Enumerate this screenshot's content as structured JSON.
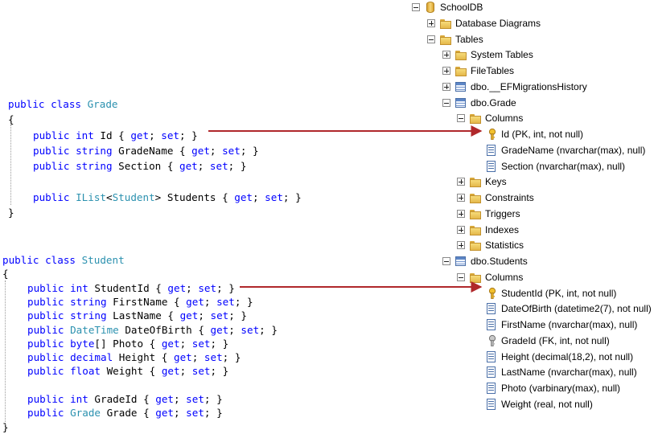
{
  "code": {
    "grade_class": [
      [
        [
          "kw",
          "public class "
        ],
        [
          "ty",
          "Grade"
        ]
      ],
      [
        [
          "",
          "{"
        ]
      ],
      [
        [
          "kw",
          "public int "
        ],
        [
          "",
          "Id { "
        ],
        [
          "kw",
          "get"
        ],
        [
          "",
          "; "
        ],
        [
          "kw",
          "set"
        ],
        [
          "",
          "; }"
        ]
      ],
      [
        [
          "kw",
          "public string "
        ],
        [
          "",
          "GradeName { "
        ],
        [
          "kw",
          "get"
        ],
        [
          "",
          "; "
        ],
        [
          "kw",
          "set"
        ],
        [
          "",
          "; }"
        ]
      ],
      [
        [
          "kw",
          "public string "
        ],
        [
          "",
          "Section { "
        ],
        [
          "kw",
          "get"
        ],
        [
          "",
          "; "
        ],
        [
          "kw",
          "set"
        ],
        [
          "",
          "; }"
        ]
      ],
      [],
      [
        [
          "kw",
          "public "
        ],
        [
          "ty",
          "IList"
        ],
        [
          "",
          "<"
        ],
        [
          "ty",
          "Student"
        ],
        [
          "",
          "> Students { "
        ],
        [
          "kw",
          "get"
        ],
        [
          "",
          "; "
        ],
        [
          "kw",
          "set"
        ],
        [
          "",
          "; }"
        ]
      ],
      [
        [
          "",
          "}"
        ]
      ]
    ],
    "student_class": [
      [
        [
          "kw",
          "public class "
        ],
        [
          "ty",
          "Student"
        ]
      ],
      [
        [
          "",
          "{"
        ]
      ],
      [
        [
          "kw",
          "public int "
        ],
        [
          "",
          "StudentId { "
        ],
        [
          "kw",
          "get"
        ],
        [
          "",
          "; "
        ],
        [
          "kw",
          "set"
        ],
        [
          "",
          "; }"
        ]
      ],
      [
        [
          "kw",
          "public string "
        ],
        [
          "",
          "FirstName { "
        ],
        [
          "kw",
          "get"
        ],
        [
          "",
          "; "
        ],
        [
          "kw",
          "set"
        ],
        [
          "",
          "; }"
        ]
      ],
      [
        [
          "kw",
          "public string "
        ],
        [
          "",
          "LastName { "
        ],
        [
          "kw",
          "get"
        ],
        [
          "",
          "; "
        ],
        [
          "kw",
          "set"
        ],
        [
          "",
          "; }"
        ]
      ],
      [
        [
          "kw",
          "public "
        ],
        [
          "ty",
          "DateTime"
        ],
        [
          "",
          " DateOfBirth { "
        ],
        [
          "kw",
          "get"
        ],
        [
          "",
          "; "
        ],
        [
          "kw",
          "set"
        ],
        [
          "",
          "; }"
        ]
      ],
      [
        [
          "kw",
          "public byte"
        ],
        [
          "",
          "[] Photo { "
        ],
        [
          "kw",
          "get"
        ],
        [
          "",
          "; "
        ],
        [
          "kw",
          "set"
        ],
        [
          "",
          "; }"
        ]
      ],
      [
        [
          "kw",
          "public decimal "
        ],
        [
          "",
          "Height { "
        ],
        [
          "kw",
          "get"
        ],
        [
          "",
          "; "
        ],
        [
          "kw",
          "set"
        ],
        [
          "",
          "; }"
        ]
      ],
      [
        [
          "kw",
          "public float "
        ],
        [
          "",
          "Weight { "
        ],
        [
          "kw",
          "get"
        ],
        [
          "",
          "; "
        ],
        [
          "kw",
          "set"
        ],
        [
          "",
          "; }"
        ]
      ],
      [],
      [
        [
          "kw",
          "public int "
        ],
        [
          "",
          "GradeId { "
        ],
        [
          "kw",
          "get"
        ],
        [
          "",
          "; "
        ],
        [
          "kw",
          "set"
        ],
        [
          "",
          "; }"
        ]
      ],
      [
        [
          "kw",
          "public "
        ],
        [
          "ty",
          "Grade"
        ],
        [
          "",
          " Grade { "
        ],
        [
          "kw",
          "get"
        ],
        [
          "",
          "; "
        ],
        [
          "kw",
          "set"
        ],
        [
          "",
          "; }"
        ]
      ],
      [
        [
          "",
          "}"
        ]
      ]
    ]
  },
  "tree": [
    {
      "label": "SchoolDB",
      "icon": "database-icon",
      "expander": "minus",
      "level": 0
    },
    {
      "label": "Database Diagrams",
      "icon": "folder-icon",
      "expander": "plus",
      "level": 1
    },
    {
      "label": "Tables",
      "icon": "folder-icon",
      "expander": "minus",
      "level": 1
    },
    {
      "label": "System Tables",
      "icon": "folder-icon",
      "expander": "plus",
      "level": 2
    },
    {
      "label": "FileTables",
      "icon": "folder-icon",
      "expander": "plus",
      "level": 2
    },
    {
      "label": "dbo.__EFMigrationsHistory",
      "icon": "table-icon",
      "expander": "plus",
      "level": 2
    },
    {
      "label": "dbo.Grade",
      "icon": "table-icon",
      "expander": "minus",
      "level": 2
    },
    {
      "label": "Columns",
      "icon": "folder-icon",
      "expander": "minus",
      "level": 3
    },
    {
      "label": "Id (PK, int, not null)",
      "icon": "primary-key-icon",
      "expander": "none",
      "level": 4
    },
    {
      "label": "GradeName (nvarchar(max), null)",
      "icon": "column-icon",
      "expander": "none",
      "level": 4
    },
    {
      "label": "Section (nvarchar(max), null)",
      "icon": "column-icon",
      "expander": "none",
      "level": 4
    },
    {
      "label": "Keys",
      "icon": "folder-icon",
      "expander": "plus",
      "level": 3
    },
    {
      "label": "Constraints",
      "icon": "folder-icon",
      "expander": "plus",
      "level": 3
    },
    {
      "label": "Triggers",
      "icon": "folder-icon",
      "expander": "plus",
      "level": 3
    },
    {
      "label": "Indexes",
      "icon": "folder-icon",
      "expander": "plus",
      "level": 3
    },
    {
      "label": "Statistics",
      "icon": "folder-icon",
      "expander": "plus",
      "level": 3
    },
    {
      "label": "dbo.Students",
      "icon": "table-icon",
      "expander": "minus",
      "level": 2
    },
    {
      "label": "Columns",
      "icon": "folder-icon",
      "expander": "minus",
      "level": 3
    },
    {
      "label": "StudentId (PK, int, not null)",
      "icon": "primary-key-icon",
      "expander": "none",
      "level": 4
    },
    {
      "label": "DateOfBirth (datetime2(7), not null)",
      "icon": "column-icon",
      "expander": "none",
      "level": 4
    },
    {
      "label": "FirstName (nvarchar(max), null)",
      "icon": "column-icon",
      "expander": "none",
      "level": 4
    },
    {
      "label": "GradeId (FK, int, not null)",
      "icon": "foreign-key-icon",
      "expander": "none",
      "level": 4
    },
    {
      "label": "Height (decimal(18,2), not null)",
      "icon": "column-icon",
      "expander": "none",
      "level": 4
    },
    {
      "label": "LastName (nvarchar(max), null)",
      "icon": "column-icon",
      "expander": "none",
      "level": 4
    },
    {
      "label": "Photo (varbinary(max), null)",
      "icon": "column-icon",
      "expander": "none",
      "level": 4
    },
    {
      "label": "Weight (real, not null)",
      "icon": "column-icon",
      "expander": "none",
      "level": 4
    }
  ],
  "colors": {
    "keyword": "#0000ff",
    "type": "#2b91af",
    "arrow": "#b0282b"
  }
}
